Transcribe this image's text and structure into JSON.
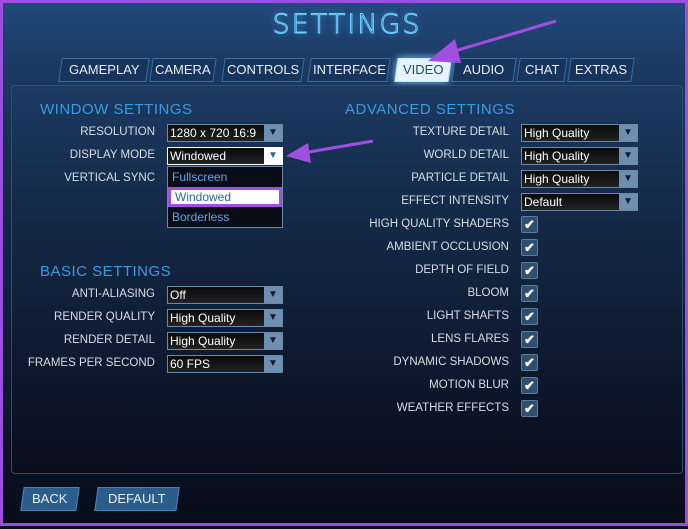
{
  "title": "SETTINGS",
  "tabs": [
    {
      "label": "GAMEPLAY"
    },
    {
      "label": "CAMERA"
    },
    {
      "label": "CONTROLS"
    },
    {
      "label": "INTERFACE"
    },
    {
      "label": "VIDEO",
      "active": true
    },
    {
      "label": "AUDIO"
    },
    {
      "label": "CHAT"
    },
    {
      "label": "EXTRAS"
    }
  ],
  "window_settings": {
    "header": "WINDOW SETTINGS",
    "resolution": {
      "label": "RESOLUTION",
      "value": "1280 x 720 16:9"
    },
    "display_mode": {
      "label": "DISPLAY MODE",
      "value": "Windowed",
      "options": [
        "Fullscreen",
        "Windowed",
        "Borderless"
      ],
      "selected": "Windowed"
    },
    "vertical_sync": {
      "label": "VERTICAL SYNC"
    }
  },
  "basic_settings": {
    "header": "BASIC SETTINGS",
    "items": [
      {
        "label": "ANTI-ALIASING",
        "value": "Off"
      },
      {
        "label": "RENDER QUALITY",
        "value": "High Quality"
      },
      {
        "label": "RENDER DETAIL",
        "value": "High Quality"
      },
      {
        "label": "FRAMES PER SECOND",
        "value": "60  FPS"
      }
    ]
  },
  "advanced_settings": {
    "header": "ADVANCED SETTINGS",
    "dropdowns": [
      {
        "label": "TEXTURE DETAIL",
        "value": "High Quality"
      },
      {
        "label": "WORLD DETAIL",
        "value": "High Quality"
      },
      {
        "label": "PARTICLE DETAIL",
        "value": "High Quality"
      },
      {
        "label": "EFFECT INTENSITY",
        "value": "Default"
      }
    ],
    "checkboxes": [
      {
        "label": "HIGH QUALITY SHADERS",
        "checked": true
      },
      {
        "label": "AMBIENT OCCLUSION",
        "checked": true
      },
      {
        "label": "DEPTH OF FIELD",
        "checked": true
      },
      {
        "label": "BLOOM",
        "checked": true
      },
      {
        "label": "LIGHT SHAFTS",
        "checked": true
      },
      {
        "label": "LENS FLARES",
        "checked": true
      },
      {
        "label": "DYNAMIC SHADOWS",
        "checked": true
      },
      {
        "label": "MOTION BLUR",
        "checked": true
      },
      {
        "label": "WEATHER EFFECTS",
        "checked": true
      }
    ]
  },
  "buttons": {
    "back": "BACK",
    "default": "DEFAULT"
  },
  "icons": {
    "dropdown": "caret-down-icon",
    "check": "checkmark-icon",
    "annotation": "arrow-icon"
  },
  "colors": {
    "accent": "#3a9be0",
    "annotation": "#a04fe0"
  }
}
